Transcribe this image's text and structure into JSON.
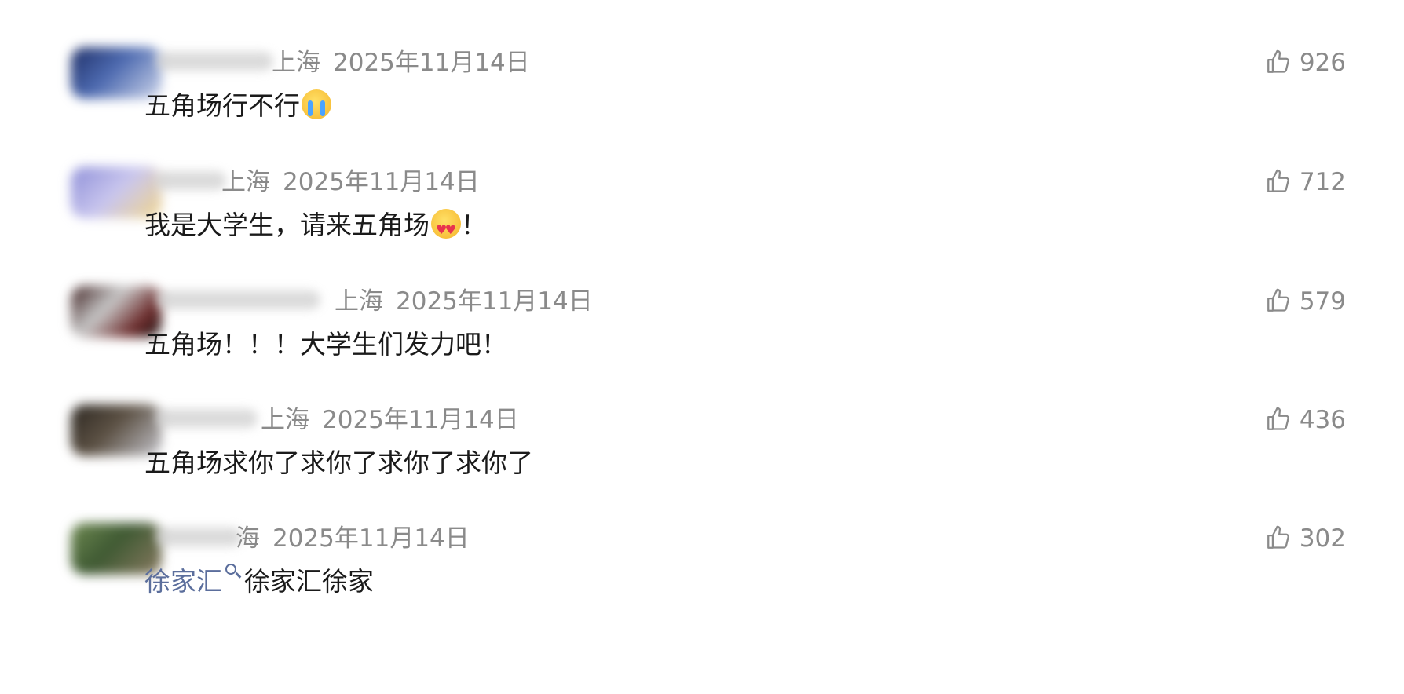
{
  "comments": [
    {
      "location": "上海",
      "date": "2025年11月14日",
      "text": "五角场行不行",
      "emoji": "loudly-crying-face",
      "likes": "926"
    },
    {
      "location": "上海",
      "date": "2025年11月14日",
      "text": "我是大学生，请来五角场",
      "emoji": "heart-eyes-face",
      "text_suffix": "！",
      "likes": "712"
    },
    {
      "location": "上海",
      "date": "2025年11月14日",
      "text": "五角场！！！大学生们发力吧！",
      "likes": "579"
    },
    {
      "location": "上海",
      "date": "2025年11月14日",
      "text": "五角场求你了求你了求你了求你了",
      "likes": "436"
    },
    {
      "location": "海",
      "date": "2025年11月14日",
      "link_text": "徐家汇",
      "link_icon": "search-icon",
      "text": "徐家汇徐家",
      "likes": "302"
    }
  ],
  "colors": {
    "meta": "#8a8a8a",
    "text": "#1a1a1a",
    "link": "#5b6e9c",
    "background": "#ffffff"
  },
  "icons": {
    "like": "thumbs-up-icon"
  }
}
